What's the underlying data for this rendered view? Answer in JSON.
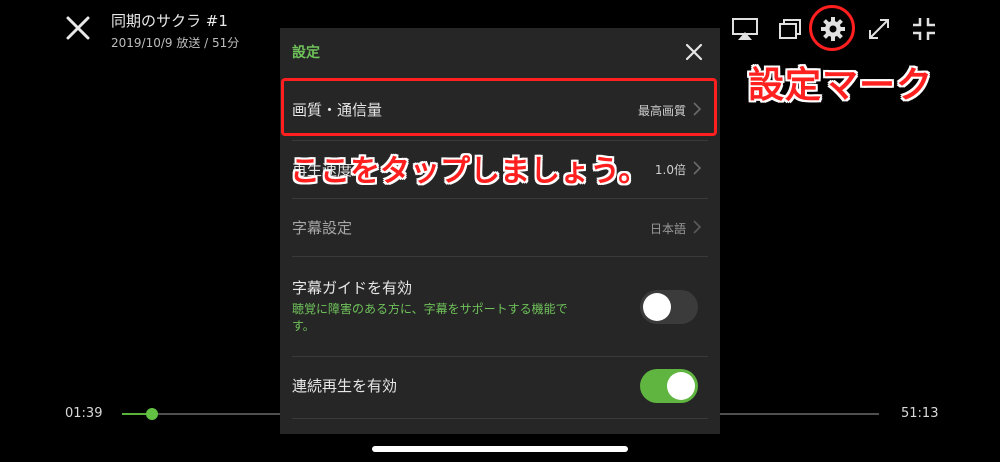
{
  "player": {
    "title": "同期のサクラ #1",
    "subtitle": "2019/10/9 放送 / 51分",
    "time_current": "01:39",
    "time_total": "51:13",
    "progress": 0.04,
    "top_icons": [
      "airplay-icon",
      "multi-window-icon",
      "gear-icon",
      "expand-icon",
      "collapse-icon"
    ]
  },
  "settings": {
    "title": "設定",
    "rows": [
      {
        "label": "画質・通信量",
        "value": "最高画質"
      },
      {
        "label": "再生速度",
        "value": "1.0倍"
      },
      {
        "label": "字幕設定",
        "value": "日本語"
      }
    ],
    "caption_guide": {
      "label": "字幕ガイドを有効",
      "description": "聴覚に障害のある方に、字幕をサポートする機能です。",
      "enabled": false
    },
    "autoplay": {
      "label": "連続再生を有効",
      "enabled": true
    }
  },
  "annotations": {
    "gear_note": "設定マーク",
    "tap_note": "ここをタップしましょう。"
  },
  "colors": {
    "accent_green": "#5fb540",
    "annotation_red": "#ff1f1f",
    "panel_bg": "#262626"
  }
}
